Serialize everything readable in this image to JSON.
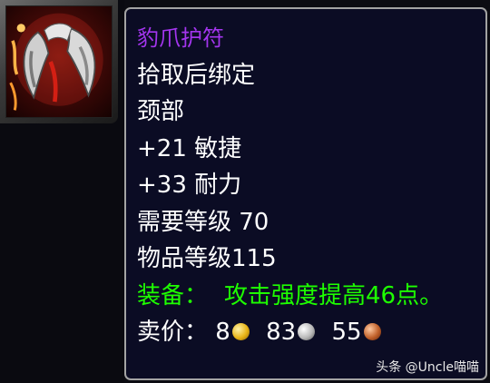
{
  "item": {
    "icon": "leopard-claw-amulet-icon",
    "name": "豹爪护符",
    "name_color": "#a335ee",
    "bind": "拾取后绑定",
    "slot": "颈部",
    "stats": [
      "+21 敏捷",
      "+33 耐力"
    ],
    "required_level": "需要等级 70",
    "item_level": "物品等级115",
    "equip_prefix": "装备：",
    "equip_text": "攻击强度提高46点。",
    "equip_color": "#1eff00",
    "sell_label": "卖价：",
    "sell_price": {
      "gold": "8",
      "silver": "83",
      "copper": "55"
    }
  },
  "watermark": "头条 @Uncle喵喵"
}
